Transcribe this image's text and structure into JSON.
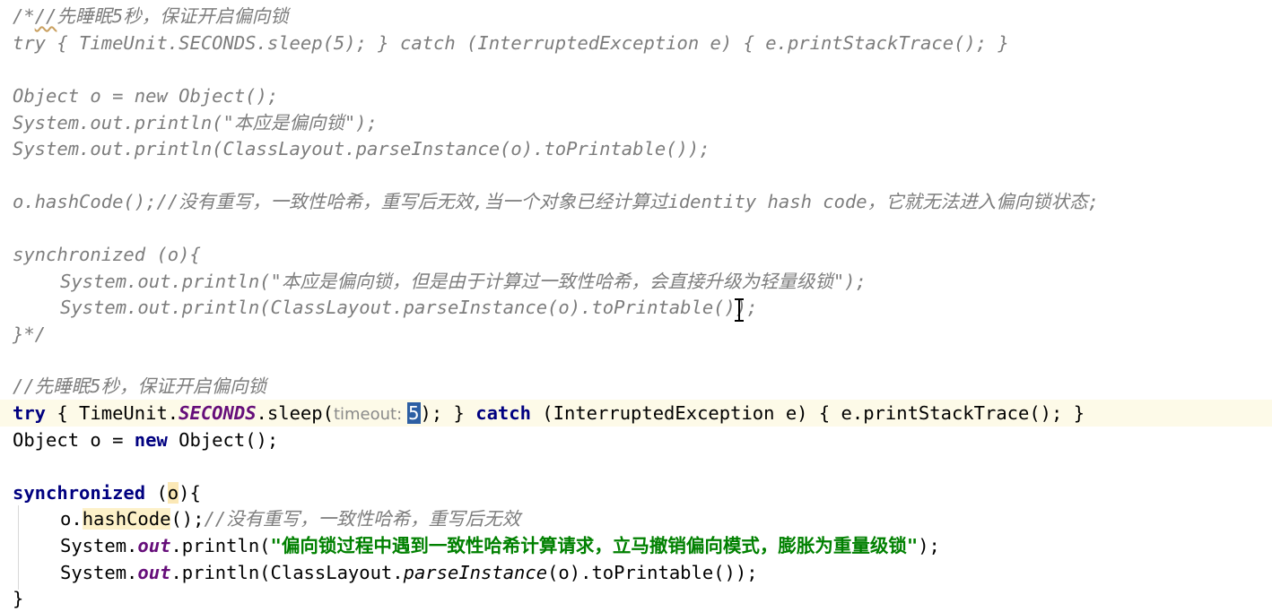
{
  "code": {
    "c1_open": "/*",
    "c1_slashes": "//",
    "c1_text": "先睡眠5秒，保证开启偏向锁",
    "c2": "try { TimeUnit.SECONDS.sleep(5); } catch (InterruptedException e) { e.printStackTrace(); }",
    "c3": "Object o = new Object();",
    "c4": "System.out.println(\"本应是偏向锁\");",
    "c5": "System.out.println(ClassLayout.parseInstance(o).toPrintable());",
    "c6": "o.hashCode();//没有重写，一致性哈希，重写后无效,当一个对象已经计算过identity hash code，它就无法进入偏向锁状态;",
    "c7": "synchronized (o){",
    "c8": "System.out.println(\"本应是偏向锁，但是由于计算过一致性哈希，会直接升级为轻量级锁\");",
    "c9": "System.out.println(ClassLayout.parseInstance(o).toPrintable());",
    "c10": "}*/",
    "l1_comment": "//先睡眠5秒，保证开启偏向锁",
    "l2": {
      "kw_try": "try",
      "p1": " { TimeUnit.",
      "field": "SECONDS",
      "p2": ".sleep(",
      "hint": "timeout:",
      "value": "5",
      "p3": "); } ",
      "kw_catch": "catch",
      "p4": " (InterruptedException e) { e.printStackTrace(); }"
    },
    "l3": {
      "p1": "Object o = ",
      "kw_new": "new",
      "p2": " Object();"
    },
    "l4": {
      "kw_sync": "synchronized",
      "p1": " (",
      "var": "o",
      "p2": "){"
    },
    "l5": {
      "var": "o",
      "p1": ".",
      "method": "hashCode",
      "p2": "();",
      "comment": "//没有重写，一致性哈希，重写后无效"
    },
    "l6": {
      "p1": "System.",
      "field": "out",
      "p2": ".println(",
      "str": "\"偏向锁过程中遇到一致性哈希计算请求，立马撤销偏向模式，膨胀为重量级锁\"",
      "p3": ");"
    },
    "l7": {
      "p1": "System.",
      "field": "out",
      "p2": ".println(ClassLayout.",
      "call": "parseInstance",
      "p3": "(o).toPrintable());"
    },
    "l8": "}"
  }
}
